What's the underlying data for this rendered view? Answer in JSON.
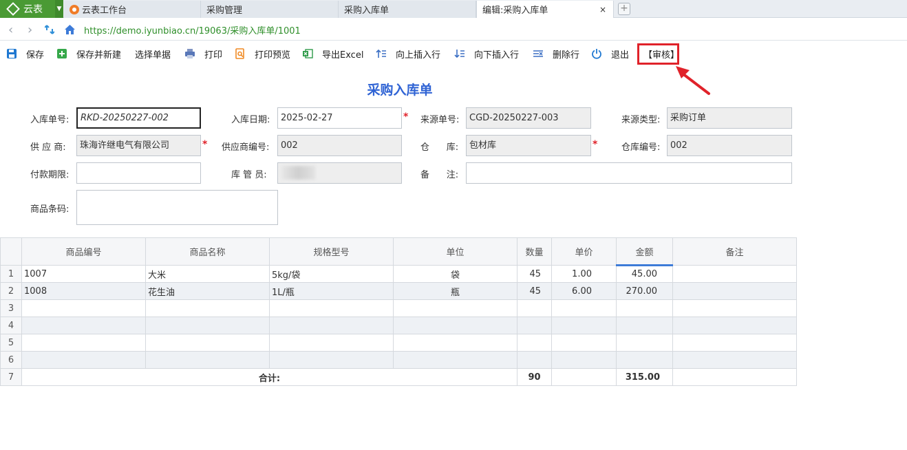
{
  "brand": {
    "name": "云表"
  },
  "tabs": [
    {
      "label": "云表工作台",
      "active": false
    },
    {
      "label": "采购管理",
      "active": false
    },
    {
      "label": "采购入库单",
      "active": false
    },
    {
      "label": "编辑:采购入库单",
      "active": true
    }
  ],
  "tab_close": "×",
  "new_tab": "+",
  "address": {
    "url": "https://demo.iyunbiao.cn/19063/采购入库单/1001"
  },
  "toolbar": {
    "save": "保存",
    "save_new": "保存并新建",
    "select_doc": "选择单据",
    "print": "打印",
    "print_preview": "打印预览",
    "export_excel": "导出Excel",
    "insert_above": "向上插入行",
    "insert_below": "向下插入行",
    "delete_row": "删除行",
    "exit": "退出",
    "audit": "【审核】"
  },
  "form": {
    "title": "采购入库单",
    "receipt_no_label": "入库单号:",
    "receipt_no": "RKD-20250227-002",
    "receipt_date_label": "入库日期:",
    "receipt_date": "2025-02-27",
    "source_no_label": "来源单号:",
    "source_no": "CGD-20250227-003",
    "source_type_label": "来源类型:",
    "source_type": "采购订单",
    "supplier_label": "供 应 商:",
    "supplier": "珠海许继电气有限公司",
    "supplier_code_label": "供应商编号:",
    "supplier_code": "002",
    "warehouse_label": "仓      库:",
    "warehouse": "包材库",
    "warehouse_code_label": "仓库编号:",
    "warehouse_code": "002",
    "payment_term_label": "付款期限:",
    "payment_term": "",
    "keeper_label": "库 管 员:",
    "remark_label": "备      注:",
    "remark": "",
    "barcode_label": "商品条码:",
    "barcode": "",
    "required_mark": "*"
  },
  "grid": {
    "headers": [
      "商品编号",
      "商品名称",
      "规格型号",
      "单位",
      "数量",
      "单价",
      "金额",
      "备注"
    ],
    "rows": [
      {
        "no": "1",
        "code": "1007",
        "name": "大米",
        "spec": "5kg/袋",
        "unit": "袋",
        "qty": "45",
        "price": "1.00",
        "amount": "45.00",
        "note": ""
      },
      {
        "no": "2",
        "code": "1008",
        "name": "花生油",
        "spec": "1L/瓶",
        "unit": "瓶",
        "qty": "45",
        "price": "6.00",
        "amount": "270.00",
        "note": ""
      },
      {
        "no": "3"
      },
      {
        "no": "4"
      },
      {
        "no": "5"
      },
      {
        "no": "6"
      }
    ],
    "total_row_no": "7",
    "total_label": "合计:",
    "total_qty": "90",
    "total_amount": "315.00"
  }
}
